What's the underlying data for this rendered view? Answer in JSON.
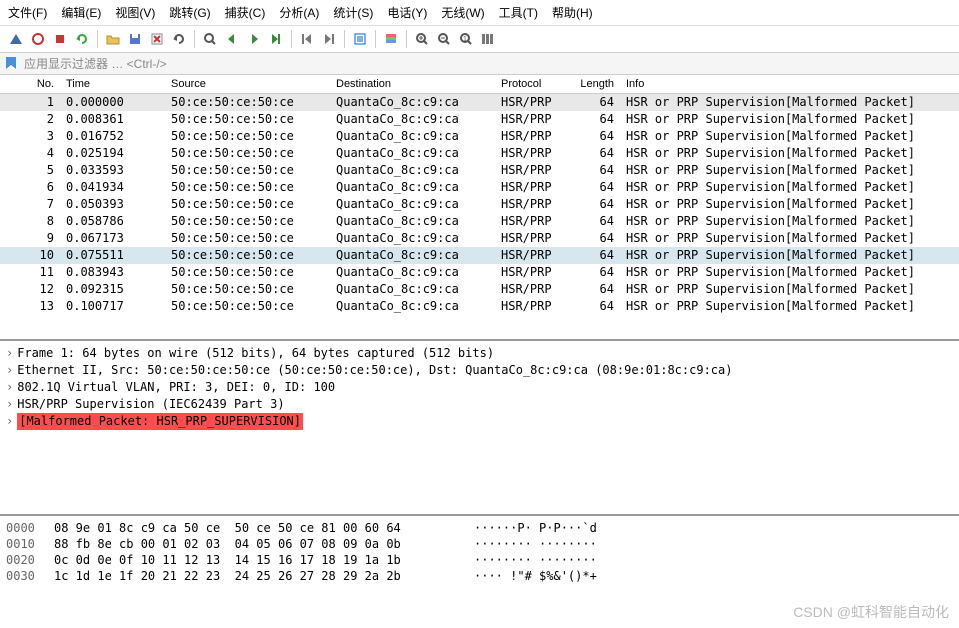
{
  "menu": [
    "文件(F)",
    "编辑(E)",
    "视图(V)",
    "跳转(G)",
    "捕获(C)",
    "分析(A)",
    "统计(S)",
    "电话(Y)",
    "无线(W)",
    "工具(T)",
    "帮助(H)"
  ],
  "filter_hint": "应用显示过滤器 … <Ctrl-/>",
  "columns": {
    "no": "No.",
    "time": "Time",
    "src": "Source",
    "dst": "Destination",
    "proto": "Protocol",
    "len": "Length",
    "info": "Info"
  },
  "packets": [
    {
      "no": 1,
      "time": "0.000000",
      "src": "50:ce:50:ce:50:ce",
      "dst": "QuantaCo_8c:c9:ca",
      "proto": "HSR/PRP",
      "len": 64,
      "info": "HSR or PRP Supervision[Malformed Packet]",
      "sel": "gray"
    },
    {
      "no": 2,
      "time": "0.008361",
      "src": "50:ce:50:ce:50:ce",
      "dst": "QuantaCo_8c:c9:ca",
      "proto": "HSR/PRP",
      "len": 64,
      "info": "HSR or PRP Supervision[Malformed Packet]"
    },
    {
      "no": 3,
      "time": "0.016752",
      "src": "50:ce:50:ce:50:ce",
      "dst": "QuantaCo_8c:c9:ca",
      "proto": "HSR/PRP",
      "len": 64,
      "info": "HSR or PRP Supervision[Malformed Packet]"
    },
    {
      "no": 4,
      "time": "0.025194",
      "src": "50:ce:50:ce:50:ce",
      "dst": "QuantaCo_8c:c9:ca",
      "proto": "HSR/PRP",
      "len": 64,
      "info": "HSR or PRP Supervision[Malformed Packet]"
    },
    {
      "no": 5,
      "time": "0.033593",
      "src": "50:ce:50:ce:50:ce",
      "dst": "QuantaCo_8c:c9:ca",
      "proto": "HSR/PRP",
      "len": 64,
      "info": "HSR or PRP Supervision[Malformed Packet]"
    },
    {
      "no": 6,
      "time": "0.041934",
      "src": "50:ce:50:ce:50:ce",
      "dst": "QuantaCo_8c:c9:ca",
      "proto": "HSR/PRP",
      "len": 64,
      "info": "HSR or PRP Supervision[Malformed Packet]"
    },
    {
      "no": 7,
      "time": "0.050393",
      "src": "50:ce:50:ce:50:ce",
      "dst": "QuantaCo_8c:c9:ca",
      "proto": "HSR/PRP",
      "len": 64,
      "info": "HSR or PRP Supervision[Malformed Packet]"
    },
    {
      "no": 8,
      "time": "0.058786",
      "src": "50:ce:50:ce:50:ce",
      "dst": "QuantaCo_8c:c9:ca",
      "proto": "HSR/PRP",
      "len": 64,
      "info": "HSR or PRP Supervision[Malformed Packet]"
    },
    {
      "no": 9,
      "time": "0.067173",
      "src": "50:ce:50:ce:50:ce",
      "dst": "QuantaCo_8c:c9:ca",
      "proto": "HSR/PRP",
      "len": 64,
      "info": "HSR or PRP Supervision[Malformed Packet]"
    },
    {
      "no": 10,
      "time": "0.075511",
      "src": "50:ce:50:ce:50:ce",
      "dst": "QuantaCo_8c:c9:ca",
      "proto": "HSR/PRP",
      "len": 64,
      "info": "HSR or PRP Supervision[Malformed Packet]",
      "sel": "blue"
    },
    {
      "no": 11,
      "time": "0.083943",
      "src": "50:ce:50:ce:50:ce",
      "dst": "QuantaCo_8c:c9:ca",
      "proto": "HSR/PRP",
      "len": 64,
      "info": "HSR or PRP Supervision[Malformed Packet]"
    },
    {
      "no": 12,
      "time": "0.092315",
      "src": "50:ce:50:ce:50:ce",
      "dst": "QuantaCo_8c:c9:ca",
      "proto": "HSR/PRP",
      "len": 64,
      "info": "HSR or PRP Supervision[Malformed Packet]"
    },
    {
      "no": 13,
      "time": "0.100717",
      "src": "50:ce:50:ce:50:ce",
      "dst": "QuantaCo_8c:c9:ca",
      "proto": "HSR/PRP",
      "len": 64,
      "info": "HSR or PRP Supervision[Malformed Packet]"
    }
  ],
  "details": [
    "Frame 1: 64 bytes on wire (512 bits), 64 bytes captured (512 bits)",
    "Ethernet II, Src: 50:ce:50:ce:50:ce (50:ce:50:ce:50:ce), Dst: QuantaCo_8c:c9:ca (08:9e:01:8c:c9:ca)",
    "802.1Q Virtual VLAN, PRI: 3, DEI: 0, ID: 100",
    "HSR/PRP Supervision (IEC62439 Part 3)"
  ],
  "malformed": "[Malformed Packet: HSR_PRP_SUPERVISION]",
  "hex": [
    {
      "off": "0000",
      "hex": "08 9e 01 8c c9 ca 50 ce  50 ce 50 ce 81 00 60 64",
      "asc": "······P· P·P···`d"
    },
    {
      "off": "0010",
      "hex": "88 fb 8e cb 00 01 02 03  04 05 06 07 08 09 0a 0b",
      "asc": "········ ········"
    },
    {
      "off": "0020",
      "hex": "0c 0d 0e 0f 10 11 12 13  14 15 16 17 18 19 1a 1b",
      "asc": "········ ········"
    },
    {
      "off": "0030",
      "hex": "1c 1d 1e 1f 20 21 22 23  24 25 26 27 28 29 2a 2b",
      "asc": "···· !\"# $%&'()*+"
    }
  ],
  "watermark": "CSDN @虹科智能自动化",
  "toolbar_icons": [
    "shark-fin-icon",
    "circle-icon",
    "stop-icon",
    "restart-icon",
    "sep",
    "folder-icon",
    "save-icon",
    "close-file-icon",
    "reload-icon",
    "sep",
    "find-icon",
    "prev-icon",
    "next-icon",
    "goto-icon",
    "sep",
    "first-icon",
    "last-icon",
    "sep",
    "auto-scroll-icon",
    "sep",
    "colorize-icon",
    "sep",
    "zoom-in-icon",
    "zoom-out-icon",
    "zoom-reset-icon",
    "resize-cols-icon"
  ]
}
